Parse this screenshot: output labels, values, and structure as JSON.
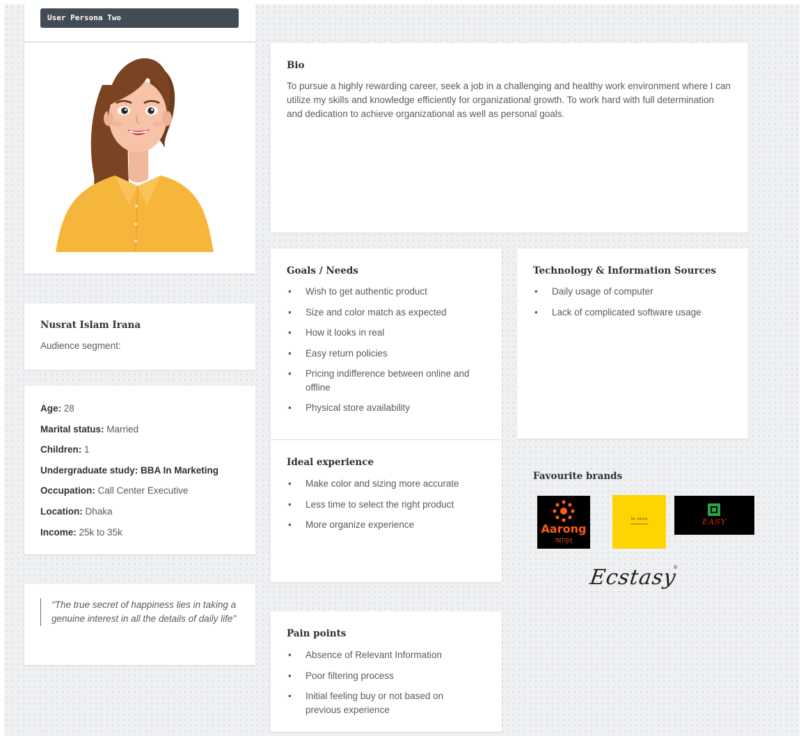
{
  "persona": {
    "title": "User Persona Two",
    "name": "Nusrat Islam Irana",
    "segment_label": "Audience segment:"
  },
  "demographics": [
    {
      "label": "Age:",
      "value": " 28"
    },
    {
      "label": "Marital status:",
      "value": " Married"
    },
    {
      "label": "Children:",
      "value": " 1"
    },
    {
      "label": "Undergraduate study: BBA In Marketing",
      "value": ""
    },
    {
      "label": "Occupation:",
      "value": " Call Center Executive"
    },
    {
      "label": "Location:",
      "value": " Dhaka"
    },
    {
      "label": "Income:",
      "value": " 25k to 35k"
    }
  ],
  "quote": "\"The true secret of happiness lies in taking a genuine interest in all the details of daily life\"",
  "bio": {
    "heading": "Bio",
    "text": "To pursue a highly rewarding career, seek a job in a challenging and healthy work environment where I can utilize my skills and knowledge efficiently for organizational growth. To work hard with full determination and dedication to achieve organizational as well as personal goals."
  },
  "goals": {
    "heading": "Goals / Needs",
    "items": [
      "Wish to get authentic product",
      "Size and color match as expected",
      "How it looks in real",
      "Easy return policies",
      "Pricing indifference between online and offline",
      "Physical store availability"
    ]
  },
  "tech": {
    "heading": "Technology & Information Sources",
    "items": [
      "Daily usage of computer",
      "Lack of complicated software usage"
    ]
  },
  "ideal": {
    "heading": "Ideal experience",
    "items": [
      "Make color and sizing more accurate",
      "Less time to select the right product",
      "More organize experience"
    ]
  },
  "pain": {
    "heading": "Pain points",
    "items": [
      "Absence of Relevant Information",
      "Poor filtering process",
      "Initial feeling buy or not based on previous experience"
    ]
  },
  "brands": {
    "heading": "Favourite brands",
    "logos": [
      {
        "name": "Aarong",
        "word": "Aarong",
        "sub": "আড়ং",
        "bg": "#000000",
        "fg": "#ff5b14"
      },
      {
        "name": "yellow-brand",
        "word": "le reve",
        "bg": "#ffd400",
        "fg": "#6b5800"
      },
      {
        "name": "Easy",
        "word": "EASY",
        "bg": "#000000",
        "fg": "#e02020",
        "mark": "#27a844"
      },
      {
        "name": "Ecstasy",
        "word": "Ecstasy"
      }
    ]
  },
  "colors": {
    "board": "#eef0f2",
    "tag": "#434b54",
    "shirt": "#f6b63c",
    "hair": "#7a4322"
  }
}
